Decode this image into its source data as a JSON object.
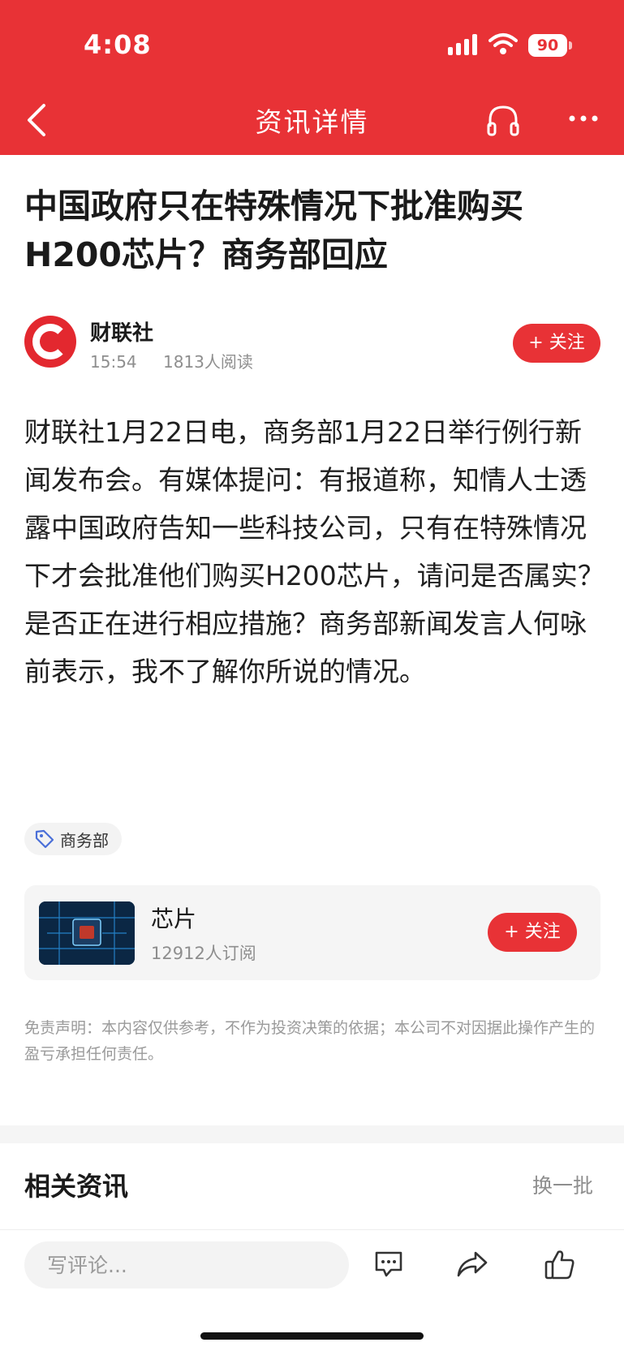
{
  "status_bar": {
    "time": "4:08",
    "battery": "90"
  },
  "nav": {
    "title": "资讯详情"
  },
  "article": {
    "title": "中国政府只在特殊情况下批准购买H200芯片？商务部回应",
    "source": "财联社",
    "time": "15:54",
    "reads": "1813人阅读",
    "follow_label": "+ 关注",
    "body": "财联社1月22日电，商务部1月22日举行例行新闻发布会。有媒体提问：有报道称，知情人士透露中国政府告知一些科技公司，只有在特殊情况下才会批准他们购买H200芯片，请问是否属实？是否正在进行相应措施？商务部新闻发言人何咏前表示，我不了解你所说的情况。",
    "tag": "商务部"
  },
  "topic": {
    "name": "芯片",
    "subscribers": "12912人订阅",
    "follow_label": "+ 关注"
  },
  "disclaimer": "免责声明：本内容仅供参考，不作为投资决策的依据；本公司不对因据此操作产生的盈亏承担任何责任。",
  "related": {
    "title": "相关资讯",
    "refresh": "换一批"
  },
  "bottom": {
    "comment_placeholder": "写评论..."
  },
  "colors": {
    "brand_red": "#e83236"
  },
  "icons": [
    "back-icon",
    "headphone-icon",
    "more-icon",
    "tag-icon",
    "comment-icon",
    "share-icon",
    "like-icon"
  ]
}
